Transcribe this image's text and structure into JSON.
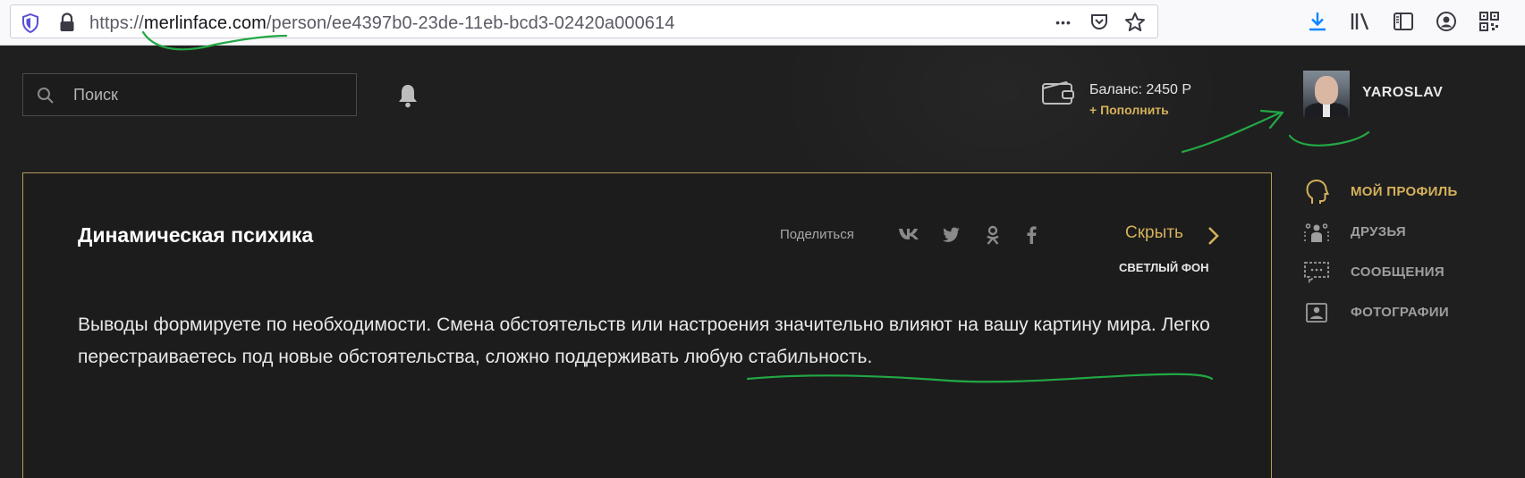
{
  "browser": {
    "url_scheme": "https://",
    "url_host": "merlinface.com",
    "url_path": "/person/ee4397b0-23de-11eb-bcd3-02420a000614",
    "more_glyph": "•••"
  },
  "header": {
    "search_placeholder": "Поиск",
    "balance": "Баланс: 2450 Р",
    "topup": "+ Пополнить",
    "username": "YAROSLAV"
  },
  "card": {
    "title": "Динамическая психика",
    "share_label": "Поделиться",
    "social": [
      "vk",
      "twitter",
      "odnoklassniki",
      "facebook"
    ],
    "hide_label": "Скрыть",
    "bg_toggle": "СВЕТЛЫЙ ФОН",
    "text": "Выводы формируете по необходимости. Смена обстоятельств или настроения значительно влияют на вашу картину мира. Легко перестраиваетесь под новые обстоятельства, сложно поддерживать любую стабильность."
  },
  "side_nav": {
    "items": [
      {
        "label": "МОЙ ПРОФИЛЬ",
        "icon": "head-profile-icon",
        "active": true
      },
      {
        "label": "ДРУЗЬЯ",
        "icon": "friends-icon",
        "active": false
      },
      {
        "label": "СООБЩЕНИЯ",
        "icon": "messages-icon",
        "active": false
      },
      {
        "label": "ФОТОГРАФИИ",
        "icon": "photos-icon",
        "active": false
      }
    ]
  },
  "colors": {
    "accent": "#d4b15a",
    "background": "#1f1f1f",
    "annotation": "#22a845"
  }
}
